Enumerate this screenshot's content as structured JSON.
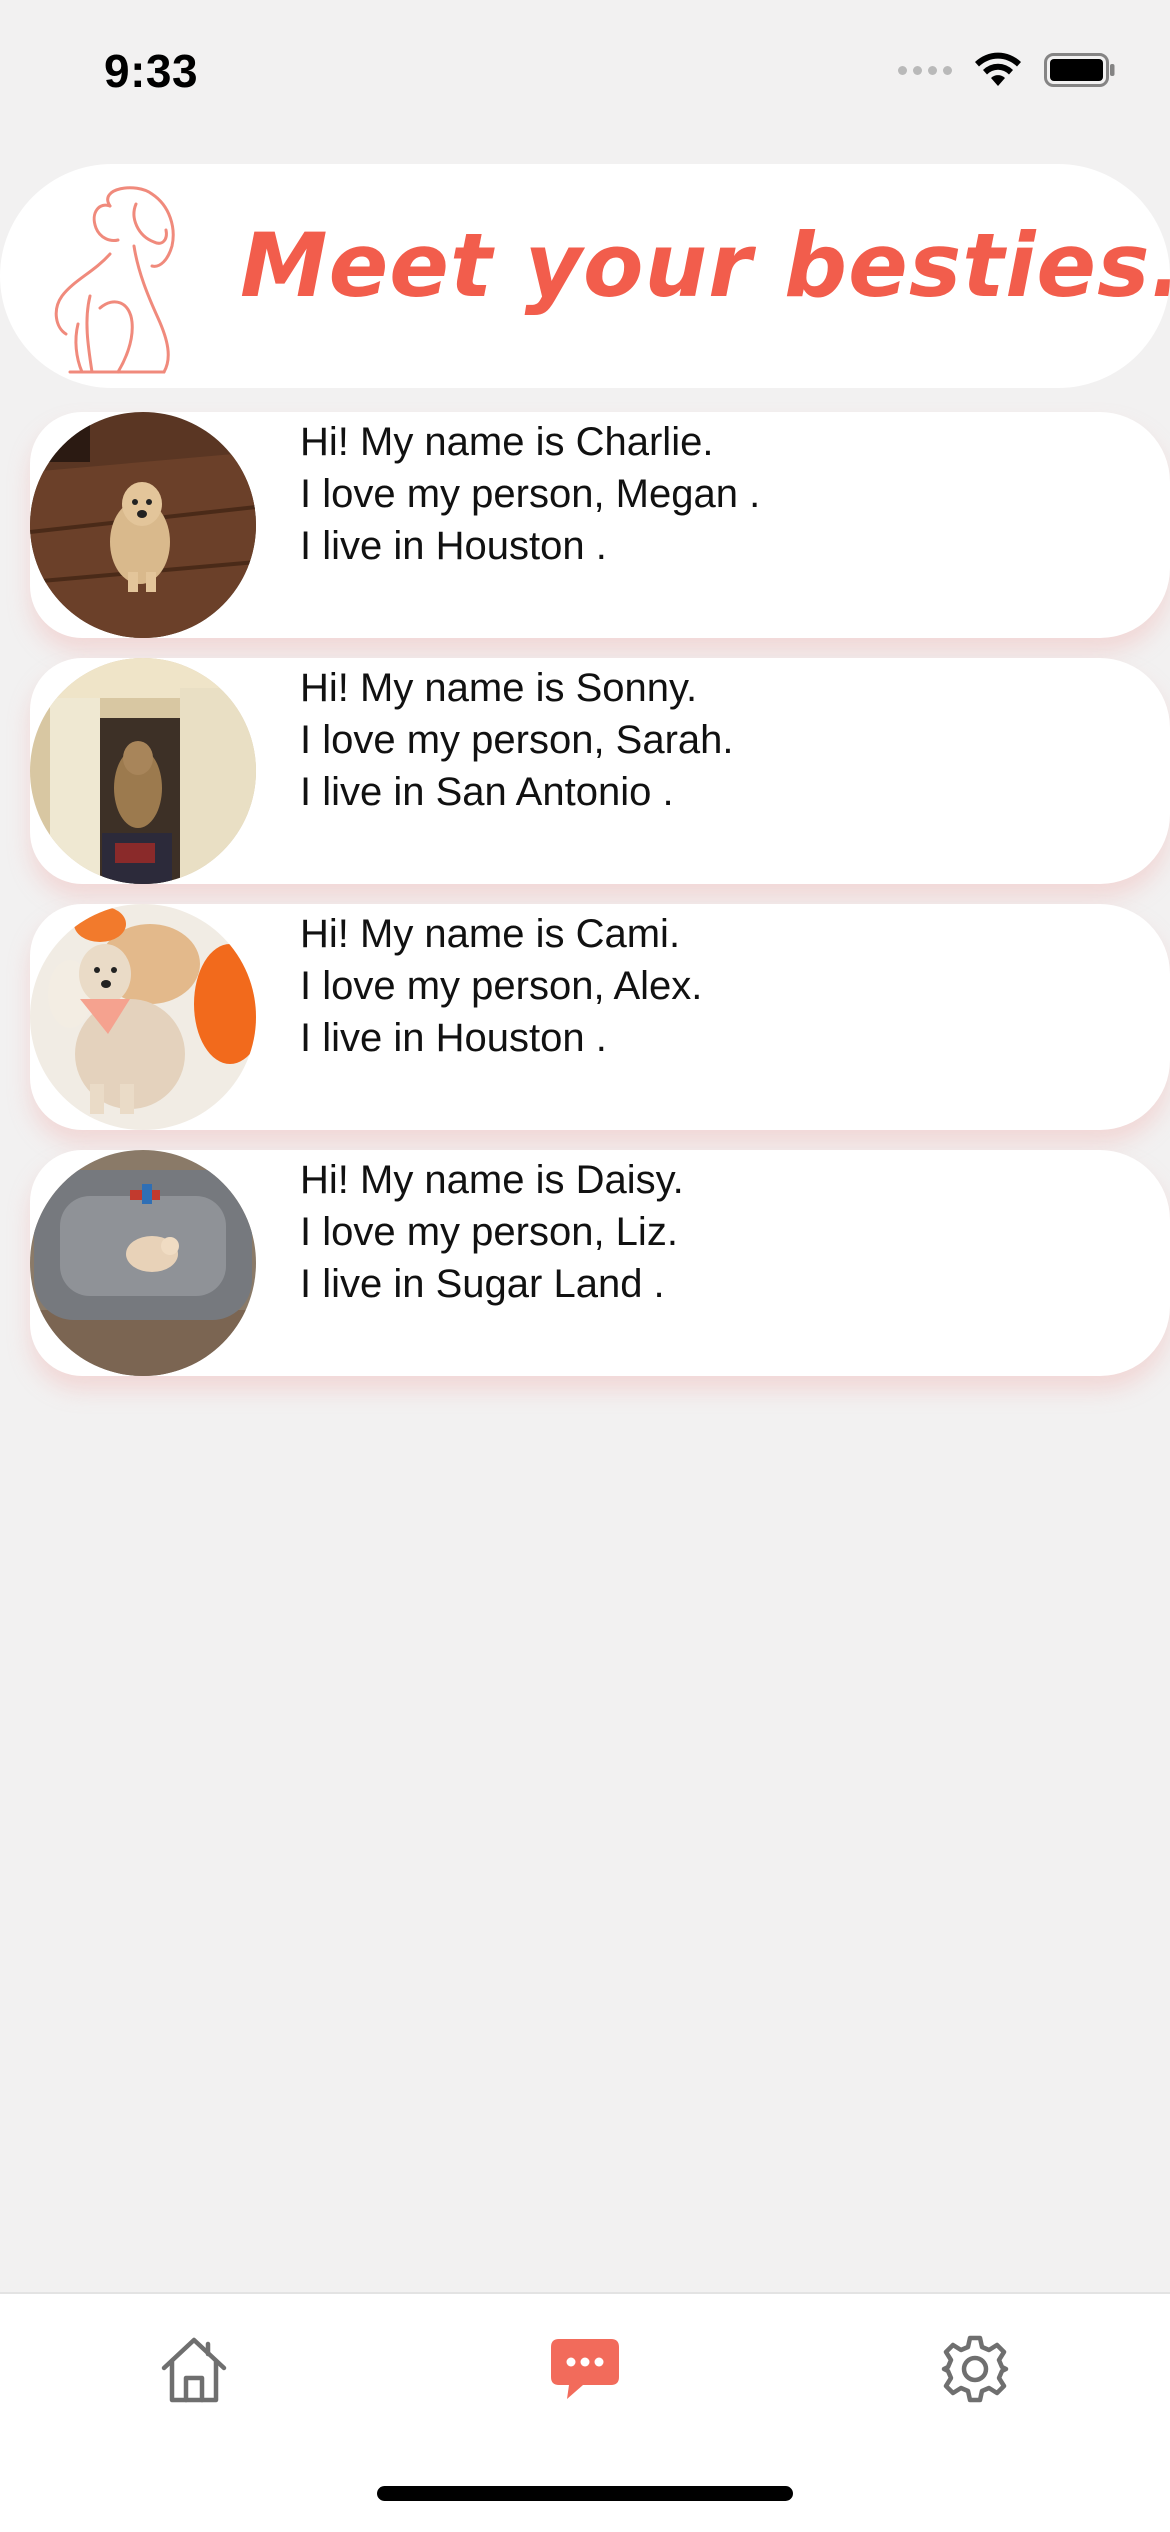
{
  "status_bar": {
    "time": "9:33"
  },
  "header": {
    "title": "Meet your besties..",
    "logo_icon": "dog-outline-icon",
    "accent_color": "#f25d4c"
  },
  "dogs": [
    {
      "line1": "Hi! My name is Charlie.",
      "line2": "I love my person, Megan .",
      "line3": "I live in Houston ."
    },
    {
      "line1": "Hi! My name is Sonny.",
      "line2": "I love my person, Sarah.",
      "line3": "I live in San Antonio ."
    },
    {
      "line1": "Hi! My name is Cami.",
      "line2": "I love my person, Alex.",
      "line3": "I live in Houston ."
    },
    {
      "line1": "Hi! My name is Daisy.",
      "line2": "I love my person, Liz.",
      "line3": "I live in Sugar Land ."
    }
  ],
  "tab_bar": {
    "tabs": [
      {
        "icon": "home-icon",
        "active": false
      },
      {
        "icon": "chat-bubble-icon",
        "active": true
      },
      {
        "icon": "gear-icon",
        "active": false
      }
    ],
    "active_color": "#f26b5b",
    "inactive_color": "#6f6f6f"
  }
}
